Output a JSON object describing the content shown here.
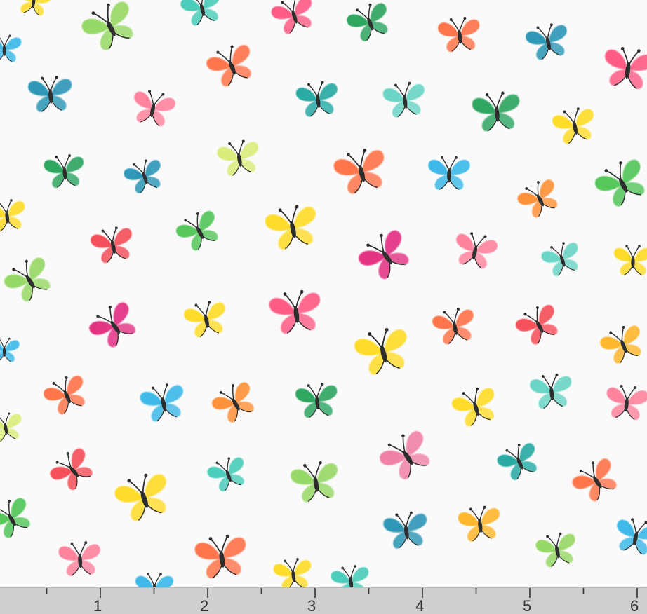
{
  "ruler": {
    "labels": [
      "1",
      "2",
      "3",
      "4",
      "5",
      "6"
    ],
    "marks_per_unit": 2
  },
  "fabric": {
    "background_color": "#fbfafa",
    "body_color": "#2e2e2e",
    "palette": [
      "#2fb4e6",
      "#1c8fb0",
      "#15a39c",
      "#3dc9b6",
      "#5fd2c2",
      "#1e9f55",
      "#46c24c",
      "#8ed65a",
      "#d6ec72",
      "#ffd91a",
      "#ffb21e",
      "#ff8a2a",
      "#ff6a3c",
      "#f4424c",
      "#ff4f7c",
      "#ff7a96",
      "#e0227a",
      "#ef78a0"
    ]
  }
}
